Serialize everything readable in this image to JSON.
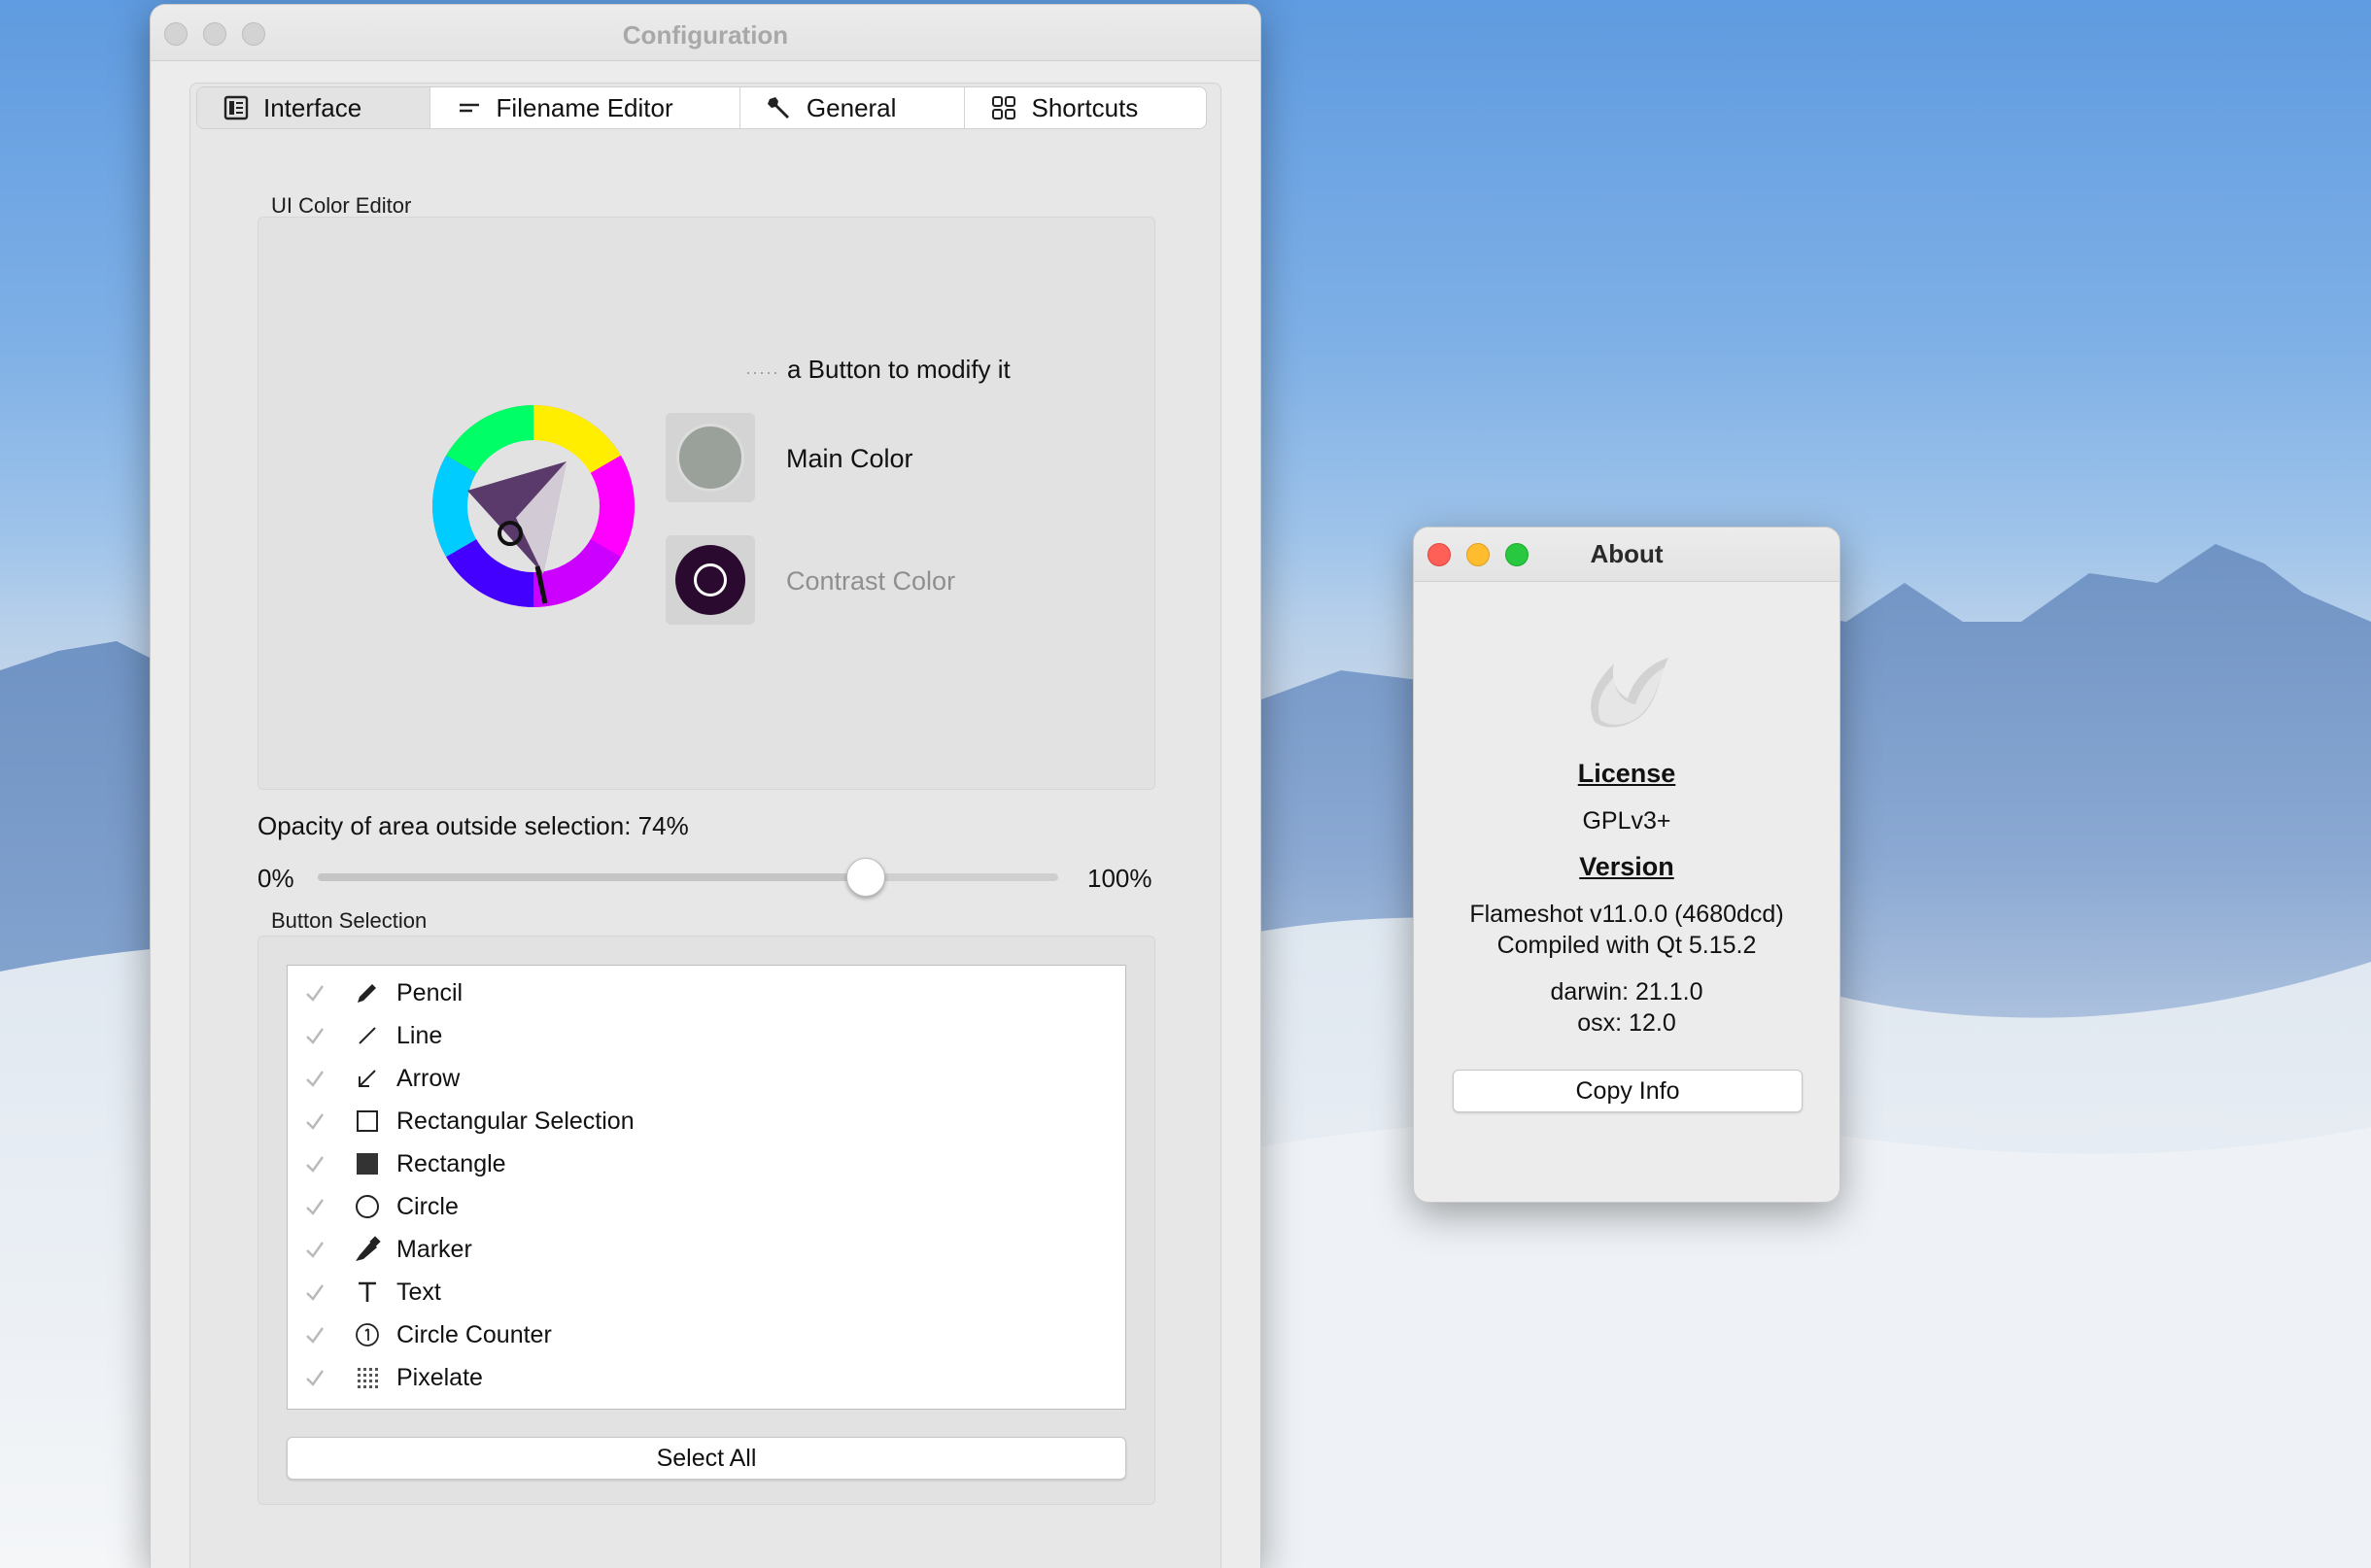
{
  "config_window": {
    "title": "Configuration",
    "tabs": [
      {
        "label": "Interface",
        "icon": "interface-icon",
        "active": true
      },
      {
        "label": "Filename Editor",
        "icon": "text-lines-icon",
        "active": false
      },
      {
        "label": "General",
        "icon": "wrench-icon",
        "active": false
      },
      {
        "label": "Shortcuts",
        "icon": "grid-icon",
        "active": false
      }
    ],
    "ui_color_editor": {
      "group_label": "UI Color Editor",
      "hint": "a Button to modify it",
      "main_color_label": "Main Color",
      "contrast_color_label": "Contrast Color",
      "main_color": "#c8c8c8",
      "contrast_color": "#2a0a2e"
    },
    "opacity": {
      "label": "Opacity of area outside selection: 74%",
      "min_label": "0%",
      "max_label": "100%",
      "value_percent": 74
    },
    "button_selection": {
      "group_label": "Button Selection",
      "items": [
        {
          "label": "Pencil",
          "icon": "pencil-icon",
          "checked": true
        },
        {
          "label": "Line",
          "icon": "line-icon",
          "checked": true
        },
        {
          "label": "Arrow",
          "icon": "arrow-icon",
          "checked": true
        },
        {
          "label": "Rectangular Selection",
          "icon": "rect-selection-icon",
          "checked": true
        },
        {
          "label": "Rectangle",
          "icon": "rectangle-icon",
          "checked": true
        },
        {
          "label": "Circle",
          "icon": "circle-icon",
          "checked": true
        },
        {
          "label": "Marker",
          "icon": "marker-icon",
          "checked": true
        },
        {
          "label": "Text",
          "icon": "text-icon",
          "checked": true
        },
        {
          "label": "Circle Counter",
          "icon": "circle-counter-icon",
          "checked": true
        },
        {
          "label": "Pixelate",
          "icon": "pixelate-icon",
          "checked": true
        }
      ],
      "select_all_label": "Select All"
    }
  },
  "about_window": {
    "title": "About",
    "license_heading": "License",
    "license_value": "GPLv3+",
    "version_heading": "Version",
    "version_line1": "Flameshot v11.0.0 (4680dcd)",
    "version_line2": "Compiled with Qt 5.15.2",
    "kernel_line": "darwin: 21.1.0",
    "os_line": "osx: 12.0",
    "copy_info_label": "Copy Info"
  }
}
